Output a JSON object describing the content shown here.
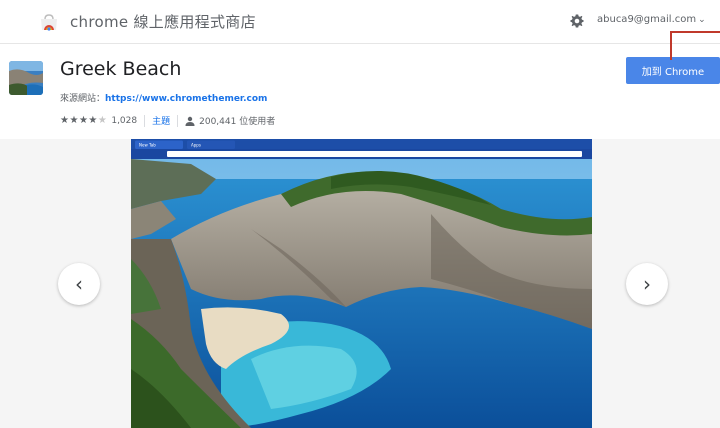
{
  "header": {
    "store_title": "chrome 線上應用程式商店",
    "account_email": "abuca9@gmail.com",
    "account_chevron": "⌄",
    "settings_icon": "gear-icon",
    "logo_icon": "chrome-web-store-icon"
  },
  "item": {
    "name": "Greek Beach",
    "source_label": "來源網站：",
    "source_url": "https://www.chromethemer.com",
    "rating_stars": 4,
    "rating_count": "1,028",
    "category": "主題",
    "users": "200,441 位使用者",
    "add_button_label": "加到 Chrome"
  },
  "gallery": {
    "prev_label": "‹",
    "next_label": "›",
    "preview_tab_1": "New Tab",
    "preview_tab_2": "Apps"
  },
  "colors": {
    "accent_button": "#4a86e8",
    "link": "#1a73e8",
    "callout": "#c0392b"
  }
}
